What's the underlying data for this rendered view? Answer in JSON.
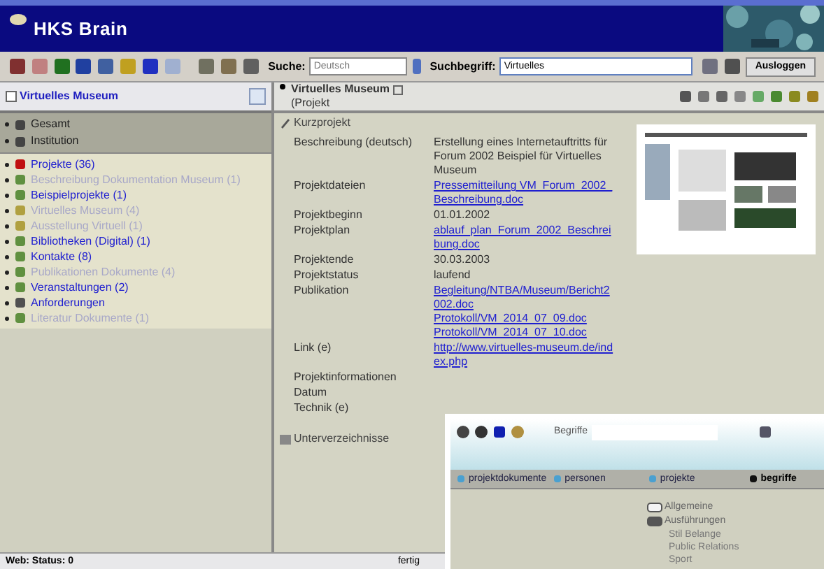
{
  "header": {
    "title": "HKS Brain"
  },
  "toolbar": {
    "search_label": "Suche:",
    "search_value": "Deutsch",
    "term_label": "Suchbegriff:",
    "term_value": "Virtuelles",
    "button": "Ausloggen"
  },
  "sidebar": {
    "title": "Virtuelles Museum",
    "top_items": [
      {
        "label": "Gesamt"
      },
      {
        "label": "Institution"
      }
    ],
    "items": [
      {
        "label": "Projekte (36)",
        "kind": "red",
        "disabled": false
      },
      {
        "label": "Beschreibung Dokumentation Museum (1)",
        "kind": "green",
        "disabled": true
      },
      {
        "label": "Beispielprojekte (1)",
        "kind": "green",
        "disabled": false
      },
      {
        "label": "Virtuelles Museum (4)",
        "kind": "yellow",
        "disabled": true
      },
      {
        "label": "Ausstellung Virtuell (1)",
        "kind": "yellow",
        "disabled": true
      },
      {
        "label": "Bibliotheken (Digital) (1)",
        "kind": "green",
        "disabled": false
      },
      {
        "label": "Kontakte (8)",
        "kind": "green",
        "disabled": false
      },
      {
        "label": "Publikationen Dokumente (4)",
        "kind": "green",
        "disabled": true
      },
      {
        "label": "Veranstaltungen (2)",
        "kind": "green",
        "disabled": false
      },
      {
        "label": "Anforderungen",
        "kind": "doc",
        "disabled": false
      },
      {
        "label": "Literatur Dokumente (1)",
        "kind": "green",
        "disabled": true
      }
    ]
  },
  "detail": {
    "title": "Virtuelles Museum",
    "subtitle": "(Projekt",
    "section": "Kurzprojekt",
    "fields": [
      {
        "label": "Beschreibung (deutsch)",
        "values": [
          {
            "kind": "text",
            "text": "Erstellung eines Internetauftritts für Forum 2002 Beispiel für Virtuelles Museum"
          }
        ]
      },
      {
        "label": "Projektdateien",
        "values": [
          {
            "kind": "link",
            "text": "Pressemitteilung VM_Forum_2002_Beschreibung.doc"
          }
        ]
      },
      {
        "label": "Projektbeginn",
        "values": [
          {
            "kind": "text",
            "text": "01.01.2002"
          }
        ]
      },
      {
        "label": "Projektplan",
        "values": [
          {
            "kind": "link",
            "text": "ablauf_plan_Forum_2002_Beschreibung.doc"
          }
        ]
      },
      {
        "label": "Projektende",
        "values": [
          {
            "kind": "text",
            "text": "30.03.2003"
          }
        ]
      },
      {
        "label": "Projektstatus",
        "values": [
          {
            "kind": "text",
            "text": "laufend"
          }
        ]
      },
      {
        "label": "Publikation",
        "values": [
          {
            "kind": "link",
            "text": "Begleitung/NTBA/Museum/Bericht2002.doc"
          },
          {
            "kind": "link",
            "text": "Protokoll/VM_2014_07_09.doc"
          },
          {
            "kind": "link",
            "text": "Protokoll/VM_2014_07_10.doc"
          }
        ]
      },
      {
        "label": "Link (e)",
        "values": [
          {
            "kind": "link",
            "text": "http://www.virtuelles-museum.de/index.php"
          }
        ]
      },
      {
        "label": "Projektinformationen"
      },
      {
        "label": "Datum"
      },
      {
        "label": "Technik (e)"
      }
    ],
    "section2": "Unterverzeichnisse"
  },
  "inset": {
    "search_label": "Begriffe",
    "tabs": [
      {
        "label": "projektdokumente",
        "selected": false
      },
      {
        "label": "personen",
        "selected": false
      },
      {
        "label": "projekte",
        "selected": false
      },
      {
        "label": "begriffe",
        "selected": true
      }
    ],
    "tree": [
      {
        "label": "Allgemeine",
        "expanded": false
      },
      {
        "label": "Ausführungen",
        "expanded": true,
        "children": [
          {
            "label": "Stil Belange"
          },
          {
            "label": "Public Relations"
          },
          {
            "label": "Sport"
          }
        ]
      }
    ]
  },
  "status_bar": {
    "left": "Web: Status: 0",
    "right": "fertig"
  }
}
